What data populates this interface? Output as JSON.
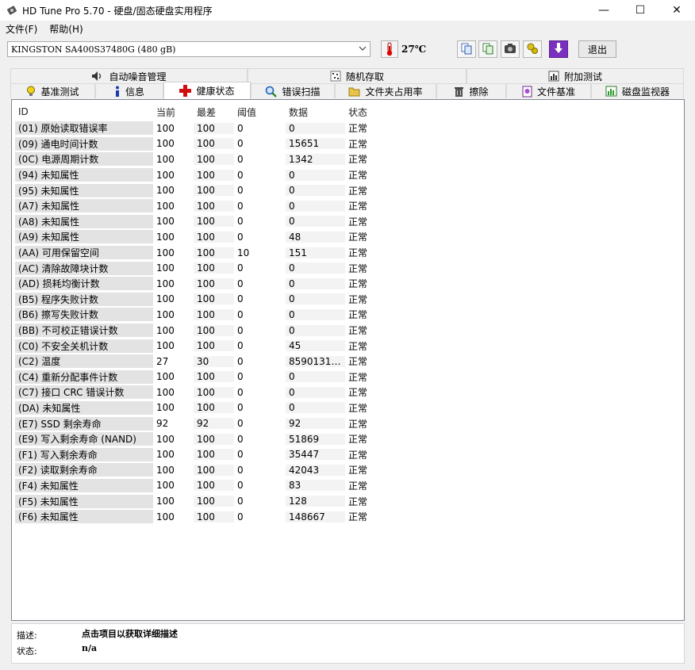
{
  "window": {
    "title": "HD Tune Pro 5.70 - 硬盘/固态硬盘实用程序",
    "minimize": "—",
    "maximize": "☐",
    "close": "✕"
  },
  "menu": [
    {
      "label": "文件(F)"
    },
    {
      "label": "帮助(H)"
    }
  ],
  "toolbar": {
    "drive": "KINGSTON SA400S37480G (480 gB)",
    "temperature": "27℃",
    "exit_label": "退出",
    "buttons": [
      "copy-info-icon",
      "copy-screen-icon",
      "camera-icon",
      "options-icon",
      "save-icon"
    ]
  },
  "tabs_top": [
    {
      "label": "自动噪音管理"
    },
    {
      "label": "随机存取"
    },
    {
      "label": "附加测试"
    }
  ],
  "tabs_bottom": [
    {
      "label": "基准测试"
    },
    {
      "label": "信息"
    },
    {
      "label": "健康状态",
      "active": true
    },
    {
      "label": "错误扫描"
    },
    {
      "label": "文件夹占用率"
    },
    {
      "label": "擦除"
    },
    {
      "label": "文件基准"
    },
    {
      "label": "磁盘监视器"
    }
  ],
  "table": {
    "columns": [
      "ID",
      "当前",
      "最差",
      "阈值",
      "数据",
      "状态"
    ],
    "rows": [
      [
        "(01) 原始读取错误率",
        "100",
        "100",
        "0",
        "0",
        "正常"
      ],
      [
        "(09) 通电时间计数",
        "100",
        "100",
        "0",
        "15651",
        "正常"
      ],
      [
        "(0C) 电源周期计数",
        "100",
        "100",
        "0",
        "1342",
        "正常"
      ],
      [
        "(94) 未知属性",
        "100",
        "100",
        "0",
        "0",
        "正常"
      ],
      [
        "(95) 未知属性",
        "100",
        "100",
        "0",
        "0",
        "正常"
      ],
      [
        "(A7) 未知属性",
        "100",
        "100",
        "0",
        "0",
        "正常"
      ],
      [
        "(A8) 未知属性",
        "100",
        "100",
        "0",
        "0",
        "正常"
      ],
      [
        "(A9) 未知属性",
        "100",
        "100",
        "0",
        "48",
        "正常"
      ],
      [
        "(AA) 可用保留空间",
        "100",
        "100",
        "10",
        "151",
        "正常"
      ],
      [
        "(AC) 清除故障块计数",
        "100",
        "100",
        "0",
        "0",
        "正常"
      ],
      [
        "(AD) 损耗均衡计数",
        "100",
        "100",
        "0",
        "0",
        "正常"
      ],
      [
        "(B5) 程序失败计数",
        "100",
        "100",
        "0",
        "0",
        "正常"
      ],
      [
        "(B6) 擦写失败计数",
        "100",
        "100",
        "0",
        "0",
        "正常"
      ],
      [
        "(BB) 不可校正错误计数",
        "100",
        "100",
        "0",
        "0",
        "正常"
      ],
      [
        "(C0) 不安全关机计数",
        "100",
        "100",
        "0",
        "45",
        "正常"
      ],
      [
        "(C2) 温度",
        "27",
        "30",
        "0",
        "85901312...",
        "正常"
      ],
      [
        "(C4) 重新分配事件计数",
        "100",
        "100",
        "0",
        "0",
        "正常"
      ],
      [
        "(C7) 接口 CRC 错误计数",
        "100",
        "100",
        "0",
        "0",
        "正常"
      ],
      [
        "(DA) 未知属性",
        "100",
        "100",
        "0",
        "0",
        "正常"
      ],
      [
        "(E7) SSD 剩余寿命",
        "92",
        "92",
        "0",
        "92",
        "正常"
      ],
      [
        "(E9) 写入剩余寿命 (NAND)",
        "100",
        "100",
        "0",
        "51869",
        "正常"
      ],
      [
        "(F1) 写入剩余寿命",
        "100",
        "100",
        "0",
        "35447",
        "正常"
      ],
      [
        "(F2) 读取剩余寿命",
        "100",
        "100",
        "0",
        "42043",
        "正常"
      ],
      [
        "(F4) 未知属性",
        "100",
        "100",
        "0",
        "83",
        "正常"
      ],
      [
        "(F5) 未知属性",
        "100",
        "100",
        "0",
        "128",
        "正常"
      ],
      [
        "(F6) 未知属性",
        "100",
        "100",
        "0",
        "148667",
        "正常"
      ]
    ]
  },
  "description": {
    "desc_label": "描述:",
    "desc_value": "点击项目以获取详细描述",
    "status_label": "状态:",
    "status_value": "n/a"
  }
}
